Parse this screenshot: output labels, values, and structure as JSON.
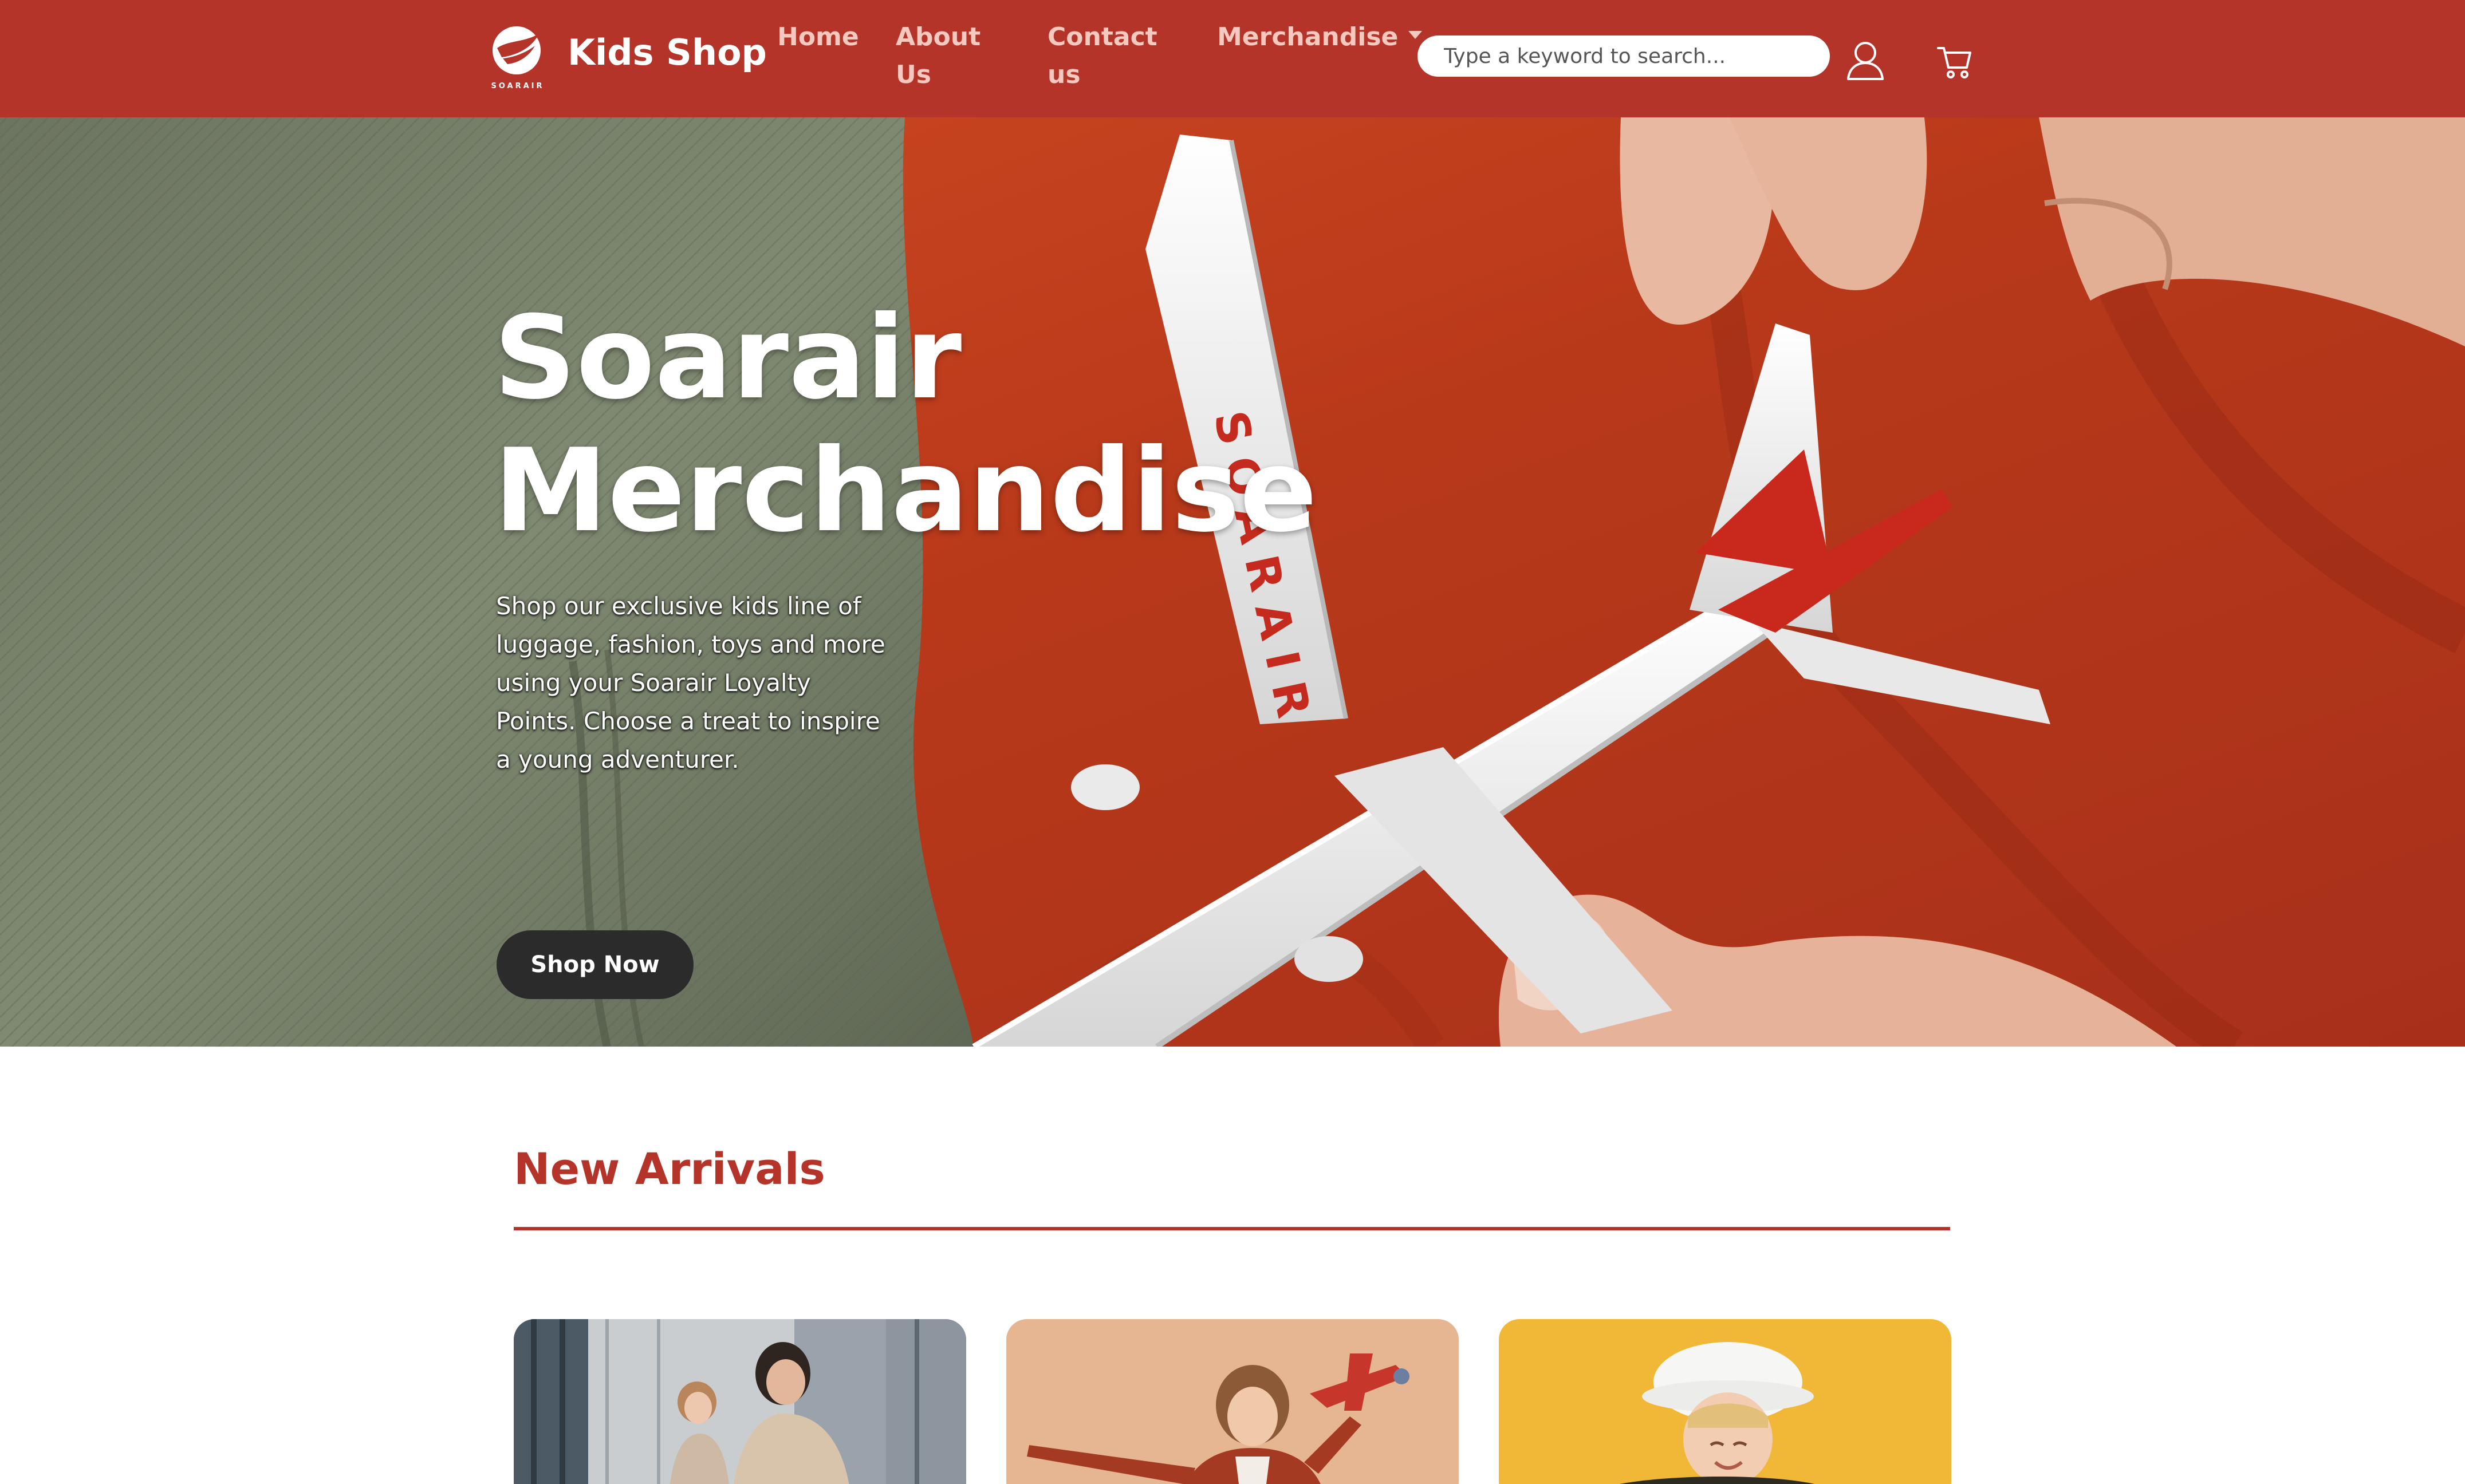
{
  "brand": {
    "logo_wordmark": "SOARAIR",
    "name": "Kids Shop"
  },
  "nav": {
    "home": "Home",
    "about": "About Us",
    "contact": "Contact us",
    "merchandise": "Merchandise"
  },
  "search": {
    "placeholder": "Type a keyword to search..."
  },
  "icons": {
    "user": "user-icon",
    "cart": "cart-icon",
    "dropdown": "caret-down-icon"
  },
  "hero": {
    "title": "Soarair Merchandise",
    "description": "Shop our exclusive kids line of luggage, fashion, toys and more using your Soarair Loyalty Points. Choose a treat to inspire a young adventurer.",
    "cta": "Shop Now",
    "plane_livery": "SOARAIR"
  },
  "new_arrivals": {
    "title": "New Arrivals",
    "cards": [
      {
        "image": "mother-and-daughter-at-airport"
      },
      {
        "image": "girl-with-toy-airplane"
      },
      {
        "image": "girl-with-yellow-suitcase"
      }
    ]
  },
  "colors": {
    "brand_red": "#b4342a",
    "button_dark": "#2b2b2b",
    "white": "#ffffff"
  }
}
